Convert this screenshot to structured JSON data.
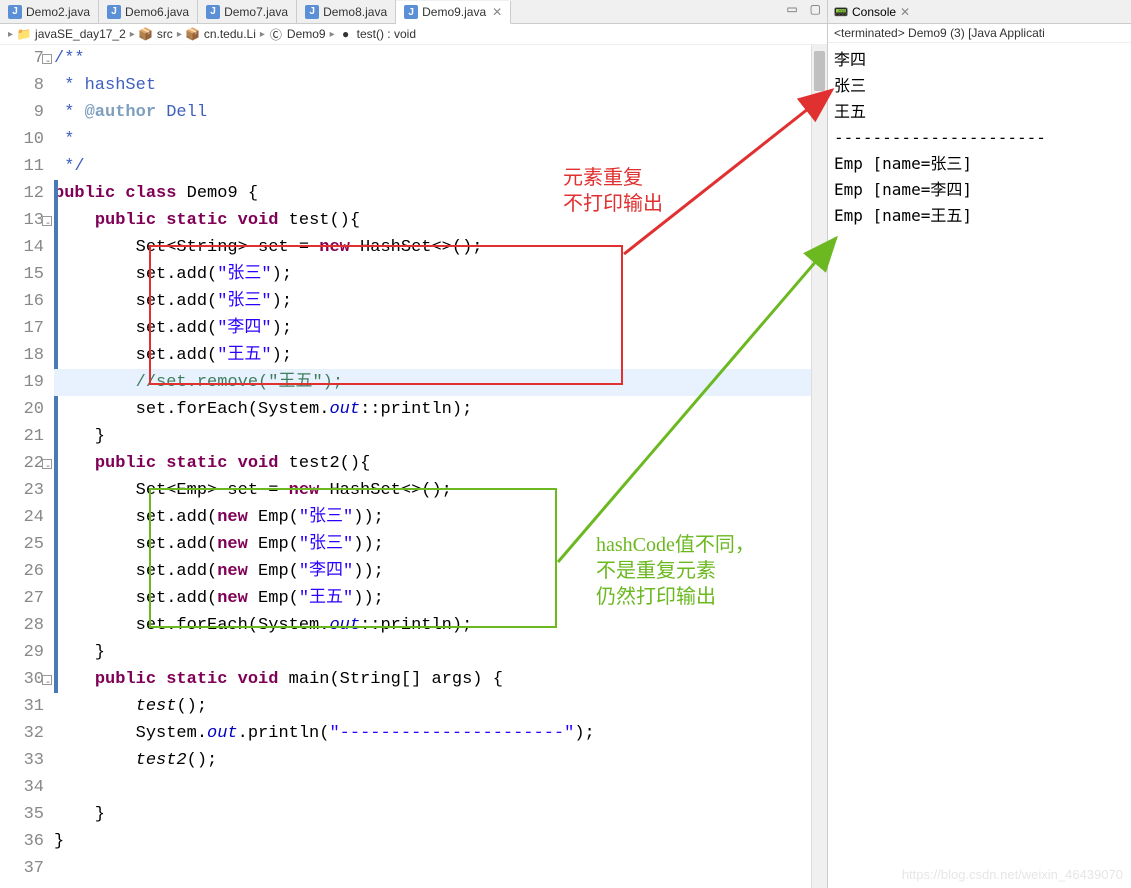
{
  "tabs": [
    {
      "label": "Demo2.java",
      "active": false
    },
    {
      "label": "Demo6.java",
      "active": false
    },
    {
      "label": "Demo7.java",
      "active": false
    },
    {
      "label": "Demo8.java",
      "active": false
    },
    {
      "label": "Demo9.java",
      "active": true
    }
  ],
  "breadcrumb": {
    "project": "javaSE_day17_2",
    "src": "src",
    "pkg": "cn.tedu.Li",
    "class": "Demo9",
    "method": "test() : void"
  },
  "code": {
    "lines": [
      {
        "n": 7,
        "fold": true,
        "html": "<span class='cmt'>/**</span>"
      },
      {
        "n": 8,
        "html": "<span class='cmt'> * hashSet</span>"
      },
      {
        "n": 9,
        "html": "<span class='cmt'> * <span class='cmt-tag'>@author</span> Dell</span>"
      },
      {
        "n": 10,
        "html": "<span class='cmt'> *</span>"
      },
      {
        "n": 11,
        "html": "<span class='cmt'> */</span>"
      },
      {
        "n": 12,
        "mark": true,
        "html": "<span class='kw'>public</span> <span class='kw'>class</span> Demo9 {"
      },
      {
        "n": 13,
        "fold": true,
        "mark": true,
        "html": "    <span class='kw'>public</span> <span class='kw'>static</span> <span class='kw'>void</span> test(){"
      },
      {
        "n": 14,
        "mark": true,
        "html": "        Set&lt;String&gt; set = <span class='kw'>new</span> HashSet&lt;&gt;();"
      },
      {
        "n": 15,
        "mark": true,
        "html": "        set.add(<span class='str'>\"张三\"</span>);"
      },
      {
        "n": 16,
        "mark": true,
        "html": "        set.add(<span class='str'>\"张三\"</span>);"
      },
      {
        "n": 17,
        "mark": true,
        "html": "        set.add(<span class='str'>\"李四\"</span>);"
      },
      {
        "n": 18,
        "mark": true,
        "html": "        set.add(<span class='str'>\"王五\"</span>);"
      },
      {
        "n": 19,
        "hl": true,
        "html": "        <span style='color:#3f7f5f'>//set.remove(\"王五\");</span>"
      },
      {
        "n": 20,
        "mark": true,
        "html": "        set.forEach(System.<span class='field'>out</span>::println);"
      },
      {
        "n": 21,
        "mark": true,
        "html": "    }"
      },
      {
        "n": 22,
        "fold": true,
        "mark": true,
        "html": "    <span class='kw'>public</span> <span class='kw'>static</span> <span class='kw'>void</span> test2(){"
      },
      {
        "n": 23,
        "mark": true,
        "html": "        Set&lt;Emp&gt; set = <span class='kw'>new</span> HashSet&lt;&gt;();"
      },
      {
        "n": 24,
        "mark": true,
        "html": "        set.add(<span class='kw'>new</span> Emp(<span class='str'>\"张三\"</span>));"
      },
      {
        "n": 25,
        "mark": true,
        "html": "        set.add(<span class='kw'>new</span> Emp(<span class='str'>\"张三\"</span>));"
      },
      {
        "n": 26,
        "mark": true,
        "html": "        set.add(<span class='kw'>new</span> Emp(<span class='str'>\"李四\"</span>));"
      },
      {
        "n": 27,
        "mark": true,
        "html": "        set.add(<span class='kw'>new</span> Emp(<span class='str'>\"王五\"</span>));"
      },
      {
        "n": 28,
        "mark": true,
        "html": "        set.forEach(System.<span class='field'>out</span>::println);"
      },
      {
        "n": 29,
        "mark": true,
        "html": "    }"
      },
      {
        "n": 30,
        "fold": true,
        "mark": true,
        "html": "    <span class='kw'>public</span> <span class='kw'>static</span> <span class='kw'>void</span> main(String[] args) {"
      },
      {
        "n": 31,
        "html": "        <span style='font-style:italic'>test</span>();"
      },
      {
        "n": 32,
        "html": "        System.<span class='field'>out</span>.println(<span class='str'>\"----------------------\"</span>);"
      },
      {
        "n": 33,
        "html": "        <span style='font-style:italic'>test2</span>();"
      },
      {
        "n": 34,
        "html": ""
      },
      {
        "n": 35,
        "html": "    }"
      },
      {
        "n": 36,
        "html": "}"
      },
      {
        "n": 37,
        "html": ""
      }
    ]
  },
  "console": {
    "title": "Console",
    "status": "<terminated> Demo9 (3) [Java Applicati",
    "output": "李四\n张三\n王五\n----------------------\nEmp [name=张三]\nEmp [name=李四]\nEmp [name=王五]"
  },
  "annotations": {
    "red_text": "元素重复\n不打印输出",
    "green_text": "hashCode值不同，\n不是重复元素\n仍然打印输出"
  },
  "watermark": "https://blog.csdn.net/weixin_46439070"
}
